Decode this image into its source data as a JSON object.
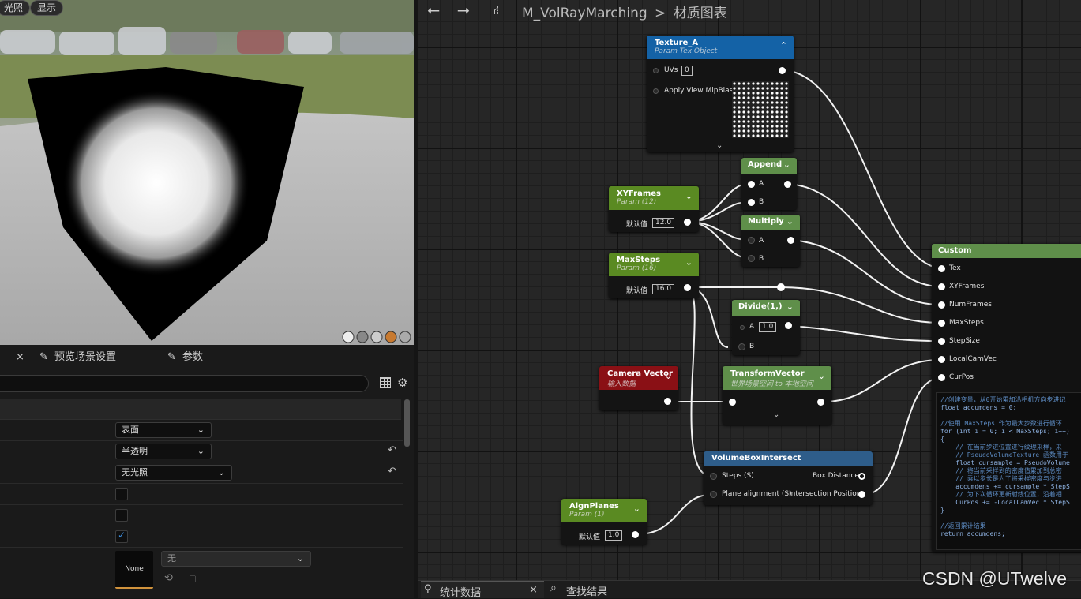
{
  "viewport": {
    "unlit_label": "光照",
    "show_label": "显示"
  },
  "details": {
    "close_label": "×",
    "tabs": [
      {
        "label": "预览场景设置"
      },
      {
        "label": "参数"
      }
    ],
    "rows": [
      {
        "value": "表面"
      },
      {
        "value": "半透明"
      },
      {
        "value": "无光照"
      },
      {
        "checked": false
      },
      {
        "checked": false
      },
      {
        "checked": true
      }
    ],
    "texture": {
      "thumb_label": "None",
      "dropdown_value": "无"
    }
  },
  "graph": {
    "breadcrumb": {
      "asset": "M_VolRayMarching",
      "separator": ">",
      "section": "材质图表"
    },
    "texture_a": {
      "title": "Texture_A",
      "subtitle": "Param Tex Object",
      "uvs_label": "UVs",
      "uvs_value": "0",
      "mipbias_label": "Apply View MipBias"
    },
    "append": {
      "title": "Append",
      "a": "A",
      "b": "B"
    },
    "multiply": {
      "title": "Multiply",
      "a": "A",
      "b": "B"
    },
    "xyframes": {
      "title": "XYFrames",
      "subtitle": "Param (12)",
      "default_label": "默认值",
      "value": "12.0"
    },
    "maxsteps": {
      "title": "MaxSteps",
      "subtitle": "Param (16)",
      "default_label": "默认值",
      "value": "16.0"
    },
    "divide": {
      "title": "Divide(1,)",
      "a": "A",
      "a_value": "1.0",
      "b": "B"
    },
    "camera_vector": {
      "title": "Camera Vector",
      "subtitle": "输入数据"
    },
    "transform_vector": {
      "title": "TransformVector",
      "subtitle": "世界场景空间 to 本地空间"
    },
    "volumebox": {
      "title": "VolumeBoxIntersect",
      "steps": "Steps (S)",
      "box_distance": "Box Distance",
      "plane_alignment": "Plane alignment (S)",
      "intersection": "Intersection Position"
    },
    "alignplanes": {
      "title": "AlgnPlanes",
      "subtitle": "Param (1)",
      "default_label": "默认值",
      "value": "1.0"
    },
    "custom": {
      "title": "Custom",
      "inputs": [
        "Tex",
        "XYFrames",
        "NumFrames",
        "MaxSteps",
        "StepSize",
        "LocalCamVec",
        "CurPos"
      ],
      "code": [
        "//创建变量，从0开始累加沿相机方向步进记",
        "float accumdens = 0;",
        "",
        "//使用 MaxSteps 作为最大步数进行循环",
        "for (int i = 0; i < MaxSteps; i++)",
        "{",
        "    // 在当前步进位置进行纹理采样，采",
        "    // PseudoVolumeTexture 函数用于",
        "    float cursample = PseudoVolume",
        "    // 将当前采样到的密度值累加到总密",
        "    // 乘以步长是为了将采样密度与步进",
        "    accumdens += cursample * StepS",
        "    // 为下次循环更新射线位置，沿着相",
        "    CurPos += -LocalCamVec * StepS",
        "}",
        "",
        "//返回累计结果",
        "return accumdens;"
      ]
    }
  },
  "bottom": {
    "stats_label": "统计数据",
    "find_label": "查找结果",
    "close_label": "×"
  },
  "watermark": "CSDN @UTwelve",
  "colors": {
    "param_green": "#5a8a22",
    "custom_green": "#5f8f4a",
    "texture_blue": "#1462a6",
    "camera_red": "#8a1015",
    "struct_blue": "#2e5d8a"
  }
}
